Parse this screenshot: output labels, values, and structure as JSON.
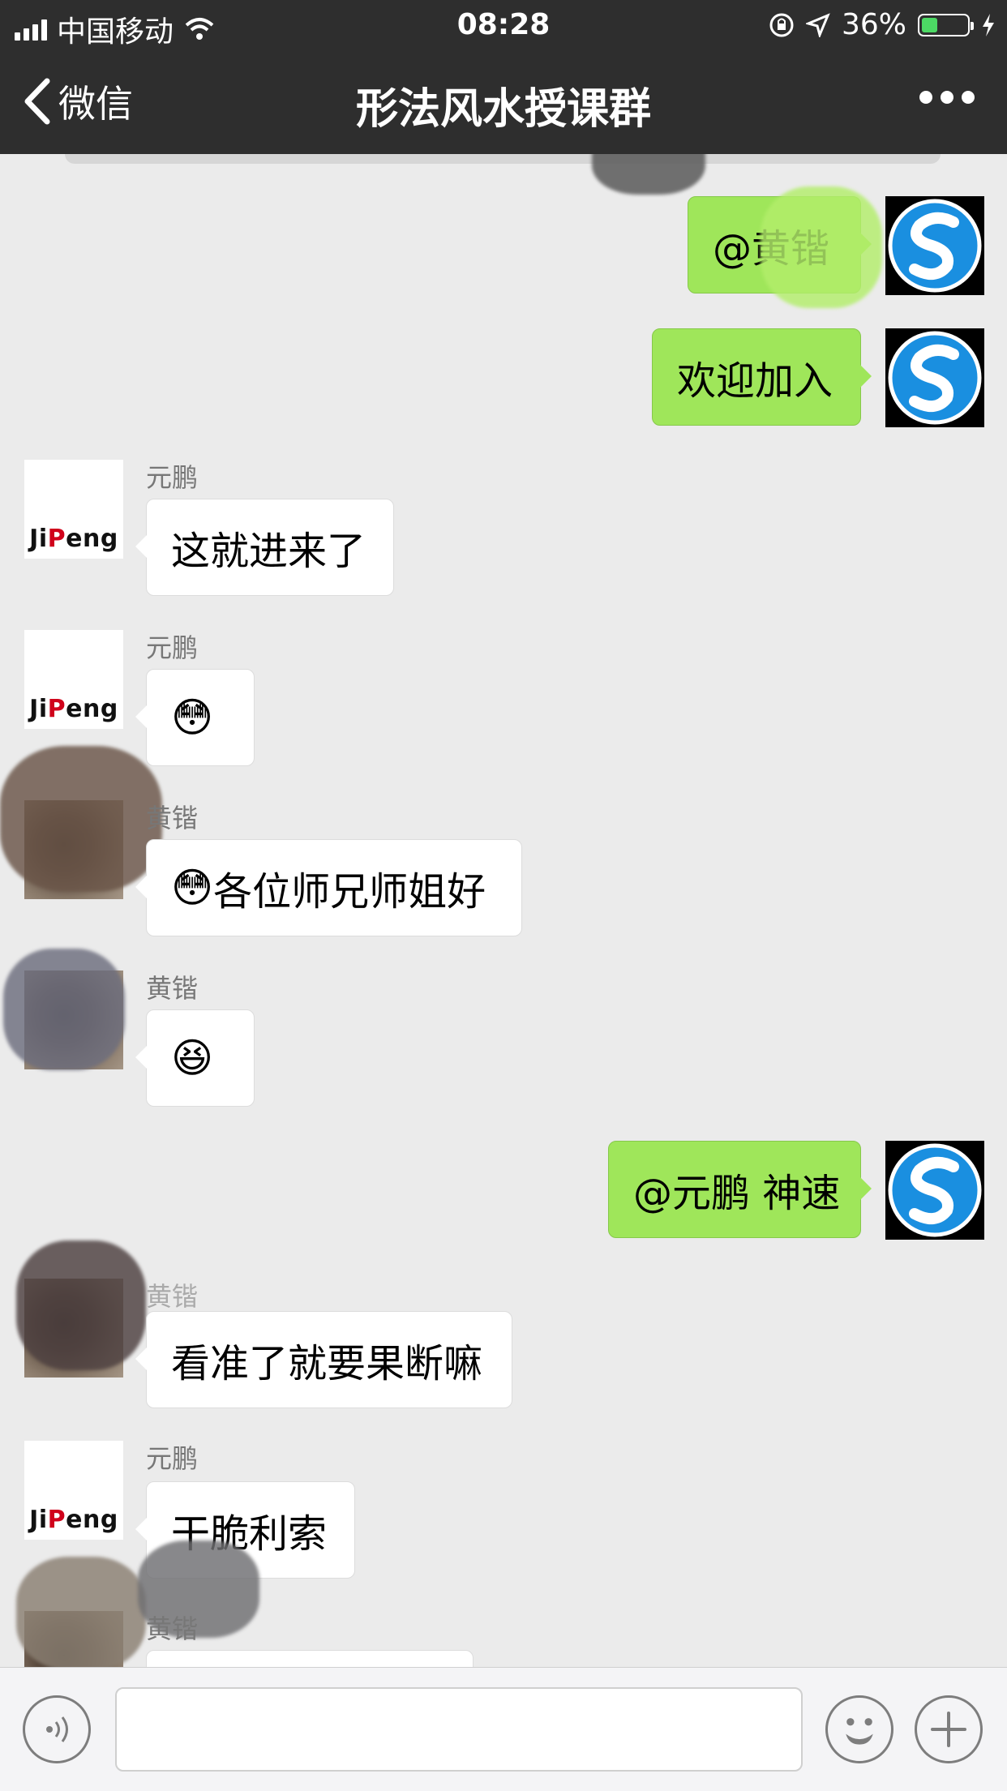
{
  "status_bar": {
    "carrier": "中国移动",
    "time": "08:28",
    "battery_percent": "36%",
    "battery_level": 0.36,
    "icons": [
      "signal-icon",
      "wifi-icon",
      "orientation-lock-icon",
      "location-icon",
      "battery-icon",
      "charging-icon"
    ]
  },
  "nav": {
    "back_label": "微信",
    "title": "形法风水授课群",
    "more_icon": "more-icon"
  },
  "colors": {
    "bar_bg": "#2e2e2e",
    "chat_bg": "#ebebeb",
    "outgoing_bubble": "#9fe65a",
    "incoming_bubble": "#ffffff",
    "battery_green": "#4cd964"
  },
  "messages": [
    {
      "direction": "out",
      "text": "@黄锴"
    },
    {
      "direction": "out",
      "text": "欢迎加入"
    },
    {
      "direction": "in",
      "sender": "元鹏",
      "text": "这就进来了"
    },
    {
      "direction": "in",
      "sender": "元鹏",
      "emoji": "😳"
    },
    {
      "direction": "in",
      "sender": "黄锴",
      "emoji": "😳",
      "text": "各位师兄师姐好"
    },
    {
      "direction": "in",
      "sender": "黄锴",
      "emoji": "😆"
    },
    {
      "direction": "out",
      "text": "@元鹏 神速"
    },
    {
      "direction": "in",
      "sender": "黄锴",
      "text": "看准了就要果断嘛"
    },
    {
      "direction": "in",
      "sender": "元鹏",
      "text": "干脆利索"
    },
    {
      "direction": "in",
      "sender": "黄锴",
      "text": ""
    }
  ],
  "avatars": {
    "self_logo": "S-logo",
    "yuanpeng_logo_text_a": "Ji",
    "yuanpeng_logo_text_b": "P",
    "yuanpeng_logo_text_c": "eng"
  },
  "bottom_bar": {
    "input_value": "",
    "icons": [
      "voice-icon",
      "emoji-icon",
      "plus-icon"
    ]
  }
}
